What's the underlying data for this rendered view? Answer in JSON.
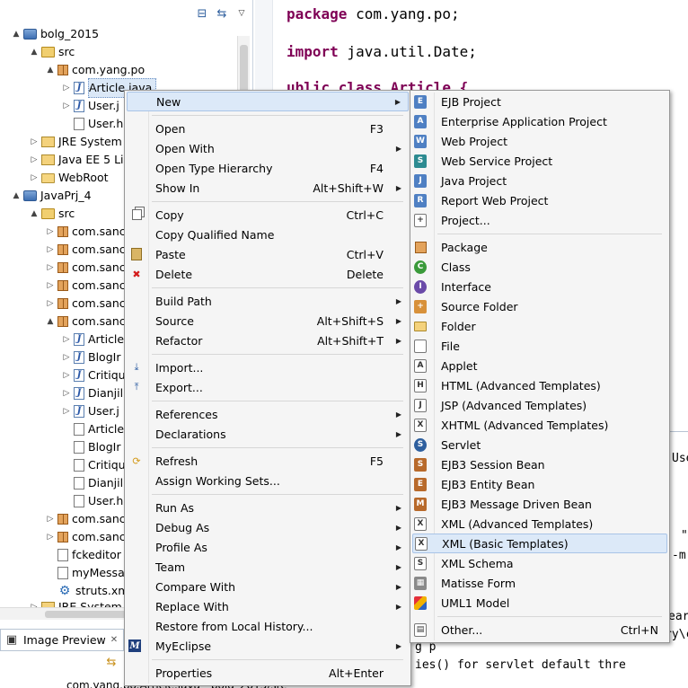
{
  "explorer": {
    "tree": [
      {
        "label": "bolg_2015",
        "icon": "project-icon",
        "twisty": "▲"
      },
      {
        "label": "src",
        "icon": "src-folder-icon",
        "twisty": "▲"
      },
      {
        "label": "com.yang.po",
        "icon": "package-icon",
        "twisty": "▲"
      },
      {
        "label": "Article.java",
        "icon": "java-file-icon",
        "twisty": "▷"
      },
      {
        "label": "User.j",
        "icon": "java-file-icon",
        "twisty": "▷"
      },
      {
        "label": "User.h",
        "icon": "file-icon",
        "twisty": ""
      },
      {
        "label": "JRE System L",
        "icon": "library-icon",
        "twisty": "▷"
      },
      {
        "label": "Java EE 5 Lib",
        "icon": "library-icon",
        "twisty": "▷"
      },
      {
        "label": "WebRoot",
        "icon": "folder-icon",
        "twisty": "▷"
      },
      {
        "label": "JavaPrj_4",
        "icon": "project-icon",
        "twisty": "▲"
      },
      {
        "label": "src",
        "icon": "src-folder-icon",
        "twisty": "▲"
      },
      {
        "label": "com.sanc",
        "icon": "package-icon",
        "twisty": "▷"
      },
      {
        "label": "com.sanc",
        "icon": "package-icon",
        "twisty": "▷"
      },
      {
        "label": "com.sanc",
        "icon": "package-icon",
        "twisty": "▷"
      },
      {
        "label": "com.sanc",
        "icon": "package-icon",
        "twisty": "▷"
      },
      {
        "label": "com.sanc",
        "icon": "package-icon",
        "twisty": "▷"
      },
      {
        "label": "com.sanc",
        "icon": "package-icon",
        "twisty": "▲"
      },
      {
        "label": "Article",
        "icon": "java-file-icon",
        "twisty": "▷"
      },
      {
        "label": "BlogIr",
        "icon": "java-file-icon",
        "twisty": "▷"
      },
      {
        "label": "Critiqu",
        "icon": "java-file-icon",
        "twisty": "▷"
      },
      {
        "label": "Dianjil",
        "icon": "java-file-icon",
        "twisty": "▷"
      },
      {
        "label": "User.j",
        "icon": "java-file-icon",
        "twisty": "▷"
      },
      {
        "label": "Article",
        "icon": "file-icon",
        "twisty": ""
      },
      {
        "label": "BlogIr",
        "icon": "file-icon",
        "twisty": ""
      },
      {
        "label": "Critiqu",
        "icon": "file-icon",
        "twisty": ""
      },
      {
        "label": "Dianjil",
        "icon": "file-icon",
        "twisty": ""
      },
      {
        "label": "User.h",
        "icon": "file-icon",
        "twisty": ""
      },
      {
        "label": "com.sanc",
        "icon": "package-icon",
        "twisty": "▷"
      },
      {
        "label": "com.sanc",
        "icon": "package-icon",
        "twisty": "▷"
      },
      {
        "label": "fckeditor",
        "icon": "xml-file-icon",
        "twisty": ""
      },
      {
        "label": "myMessa",
        "icon": "xml-file-icon",
        "twisty": ""
      },
      {
        "label": "struts.xm",
        "icon": "gear-icon",
        "twisty": ""
      },
      {
        "label": "JRE System L",
        "icon": "library-icon",
        "twisty": "▷"
      }
    ]
  },
  "editor": {
    "line1_kw": "package",
    "line1_rest": " com.yang.po;",
    "line2_kw": "import",
    "line2_rest": " java.util.Date;",
    "line3_partial": "ublic class Article {"
  },
  "image_preview": {
    "tab_label": "Image Preview",
    "close_glyph": "✕"
  },
  "status": {
    "path": "com.yang.po.Article.java - bolg_2015/src"
  },
  "console": {
    "frag1": "Use",
    "frag2": "\"",
    "frag3": "-m",
    "frag4": "ear",
    "frag5": "ry\\c",
    "frag6": "g p",
    "frag7": "ies() for servlet default thre"
  },
  "context_menu": {
    "items": [
      {
        "label": "New",
        "shortcut": "",
        "submenu": true,
        "icon": ""
      },
      {
        "label": "Open",
        "shortcut": "F3",
        "submenu": false,
        "icon": ""
      },
      {
        "label": "Open With",
        "shortcut": "",
        "submenu": true,
        "icon": ""
      },
      {
        "label": "Open Type Hierarchy",
        "shortcut": "F4",
        "submenu": false,
        "icon": ""
      },
      {
        "label": "Show In",
        "shortcut": "Alt+Shift+W",
        "submenu": true,
        "icon": ""
      },
      {
        "label": "Copy",
        "shortcut": "Ctrl+C",
        "submenu": false,
        "icon": "copy-icon"
      },
      {
        "label": "Copy Qualified Name",
        "shortcut": "",
        "submenu": false,
        "icon": ""
      },
      {
        "label": "Paste",
        "shortcut": "Ctrl+V",
        "submenu": false,
        "icon": "paste-icon"
      },
      {
        "label": "Delete",
        "shortcut": "Delete",
        "submenu": false,
        "icon": "delete-icon"
      },
      {
        "label": "Build Path",
        "shortcut": "",
        "submenu": true,
        "icon": ""
      },
      {
        "label": "Source",
        "shortcut": "Alt+Shift+S",
        "submenu": true,
        "icon": ""
      },
      {
        "label": "Refactor",
        "shortcut": "Alt+Shift+T",
        "submenu": true,
        "icon": ""
      },
      {
        "label": "Import...",
        "shortcut": "",
        "submenu": false,
        "icon": "import-icon"
      },
      {
        "label": "Export...",
        "shortcut": "",
        "submenu": false,
        "icon": "export-icon"
      },
      {
        "label": "References",
        "shortcut": "",
        "submenu": true,
        "icon": ""
      },
      {
        "label": "Declarations",
        "shortcut": "",
        "submenu": true,
        "icon": ""
      },
      {
        "label": "Refresh",
        "shortcut": "F5",
        "submenu": false,
        "icon": "refresh-icon"
      },
      {
        "label": "Assign Working Sets...",
        "shortcut": "",
        "submenu": false,
        "icon": ""
      },
      {
        "label": "Run As",
        "shortcut": "",
        "submenu": true,
        "icon": ""
      },
      {
        "label": "Debug As",
        "shortcut": "",
        "submenu": true,
        "icon": ""
      },
      {
        "label": "Profile As",
        "shortcut": "",
        "submenu": true,
        "icon": ""
      },
      {
        "label": "Team",
        "shortcut": "",
        "submenu": true,
        "icon": ""
      },
      {
        "label": "Compare With",
        "shortcut": "",
        "submenu": true,
        "icon": ""
      },
      {
        "label": "Replace With",
        "shortcut": "",
        "submenu": true,
        "icon": ""
      },
      {
        "label": "Restore from Local History...",
        "shortcut": "",
        "submenu": false,
        "icon": ""
      },
      {
        "label": "MyEclipse",
        "shortcut": "",
        "submenu": true,
        "icon": "myeclipse-icon"
      },
      {
        "label": "Properties",
        "shortcut": "Alt+Enter",
        "submenu": false,
        "icon": ""
      }
    ]
  },
  "new_submenu": {
    "items": [
      {
        "label": "EJB Project",
        "shortcut": "",
        "icon": "ejb-project-icon"
      },
      {
        "label": "Enterprise Application Project",
        "shortcut": "",
        "icon": "enterprise-project-icon"
      },
      {
        "label": "Web Project",
        "shortcut": "",
        "icon": "web-project-icon"
      },
      {
        "label": "Web Service Project",
        "shortcut": "",
        "icon": "web-service-project-icon"
      },
      {
        "label": "Java Project",
        "shortcut": "",
        "icon": "java-project-icon"
      },
      {
        "label": "Report Web Project",
        "shortcut": "",
        "icon": "report-web-project-icon"
      },
      {
        "label": "Project...",
        "shortcut": "",
        "icon": "project-icon"
      },
      {
        "label": "Package",
        "shortcut": "",
        "icon": "package-icon"
      },
      {
        "label": "Class",
        "shortcut": "",
        "icon": "class-icon"
      },
      {
        "label": "Interface",
        "shortcut": "",
        "icon": "interface-icon"
      },
      {
        "label": "Source Folder",
        "shortcut": "",
        "icon": "source-folder-icon"
      },
      {
        "label": "Folder",
        "shortcut": "",
        "icon": "folder-icon"
      },
      {
        "label": "File",
        "shortcut": "",
        "icon": "file-icon"
      },
      {
        "label": "Applet",
        "shortcut": "",
        "icon": "applet-icon"
      },
      {
        "label": "HTML (Advanced Templates)",
        "shortcut": "",
        "icon": "html-icon"
      },
      {
        "label": "JSP (Advanced Templates)",
        "shortcut": "",
        "icon": "jsp-icon"
      },
      {
        "label": "XHTML (Advanced Templates)",
        "shortcut": "",
        "icon": "xhtml-icon"
      },
      {
        "label": "Servlet",
        "shortcut": "",
        "icon": "servlet-icon"
      },
      {
        "label": "EJB3 Session Bean",
        "shortcut": "",
        "icon": "session-bean-icon"
      },
      {
        "label": "EJB3 Entity Bean",
        "shortcut": "",
        "icon": "entity-bean-icon"
      },
      {
        "label": "EJB3 Message Driven Bean",
        "shortcut": "",
        "icon": "message-bean-icon"
      },
      {
        "label": "XML (Advanced Templates)",
        "shortcut": "",
        "icon": "xml-icon"
      },
      {
        "label": "XML (Basic Templates)",
        "shortcut": "",
        "icon": "xml-icon"
      },
      {
        "label": "XML Schema",
        "shortcut": "",
        "icon": "xml-schema-icon"
      },
      {
        "label": "Matisse Form",
        "shortcut": "",
        "icon": "matisse-form-icon"
      },
      {
        "label": "UML1 Model",
        "shortcut": "",
        "icon": "uml-model-icon"
      },
      {
        "label": "Other...",
        "shortcut": "Ctrl+N",
        "icon": "other-icon"
      }
    ]
  }
}
